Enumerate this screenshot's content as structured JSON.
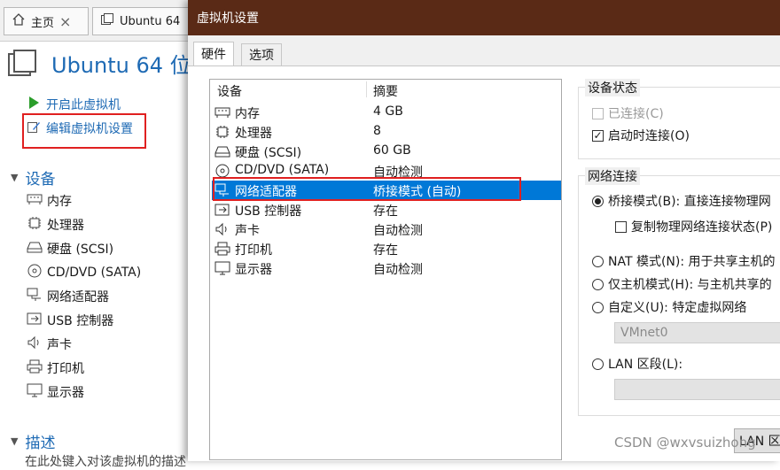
{
  "background_window": {
    "tabs": [
      {
        "label": "主页"
      },
      {
        "label": "Ubuntu 64"
      }
    ],
    "vm_title": "Ubuntu 64 位",
    "actions": {
      "start": "开启此虚拟机",
      "edit": "编辑虚拟机设置"
    },
    "devices_section": "设备",
    "devices": [
      {
        "label": "内存",
        "icon": "memory-icon"
      },
      {
        "label": "处理器",
        "icon": "processor-icon"
      },
      {
        "label": "硬盘 (SCSI)",
        "icon": "hard-disk-icon"
      },
      {
        "label": "CD/DVD (SATA)",
        "icon": "cd-dvd-icon"
      },
      {
        "label": "网络适配器",
        "icon": "network-adapter-icon"
      },
      {
        "label": "USB 控制器",
        "icon": "usb-icon"
      },
      {
        "label": "声卡",
        "icon": "sound-icon"
      },
      {
        "label": "打印机",
        "icon": "printer-icon"
      },
      {
        "label": "显示器",
        "icon": "display-icon"
      }
    ],
    "description_section": "描述",
    "description_text": "在此处键入对该虚拟机的描述"
  },
  "dialog": {
    "title": "虚拟机设置",
    "tabs": [
      {
        "label": "硬件",
        "active": true
      },
      {
        "label": "选项",
        "active": false
      }
    ],
    "list_headers": {
      "device": "设备",
      "summary": "摘要"
    },
    "rows": [
      {
        "device": "内存",
        "summary": "4 GB",
        "icon": "memory-icon"
      },
      {
        "device": "处理器",
        "summary": "8",
        "icon": "processor-icon"
      },
      {
        "device": "硬盘 (SCSI)",
        "summary": "60 GB",
        "icon": "hard-disk-icon"
      },
      {
        "device": "CD/DVD (SATA)",
        "summary": "自动检测",
        "icon": "cd-dvd-icon"
      },
      {
        "device": "网络适配器",
        "summary": "桥接模式 (自动)",
        "icon": "network-adapter-icon",
        "selected": true
      },
      {
        "device": "USB 控制器",
        "summary": "存在",
        "icon": "usb-icon"
      },
      {
        "device": "声卡",
        "summary": "自动检测",
        "icon": "sound-icon"
      },
      {
        "device": "打印机",
        "summary": "存在",
        "icon": "printer-icon"
      },
      {
        "device": "显示器",
        "summary": "自动检测",
        "icon": "display-icon"
      }
    ],
    "device_status": {
      "title": "设备状态",
      "connected": {
        "label": "已连接(C)",
        "checked": false,
        "enabled": false
      },
      "connect_at_power_on": {
        "label": "启动时连接(O)",
        "checked": true
      }
    },
    "network_connection": {
      "title": "网络连接",
      "bridged": {
        "label": "桥接模式(B): 直接连接物理网",
        "selected": true
      },
      "replicate": {
        "label": "复制物理网络连接状态(P)",
        "checked": false
      },
      "nat": {
        "label": "NAT 模式(N): 用于共享主机的"
      },
      "host_only": {
        "label": "仅主机模式(H): 与主机共享的"
      },
      "custom": {
        "label": "自定义(U): 特定虚拟网络"
      },
      "custom_value": "VMnet0",
      "lan_segment": {
        "label": "LAN 区段(L):"
      },
      "lan_segment_value": ""
    },
    "lan_button": "LAN 区"
  },
  "watermark": "CSDN @wxvsuizhong",
  "colors": {
    "titlebar": "#5a2a16",
    "selection": "#0078d7",
    "highlight": "#e02020",
    "link": "#1e6ab4"
  }
}
